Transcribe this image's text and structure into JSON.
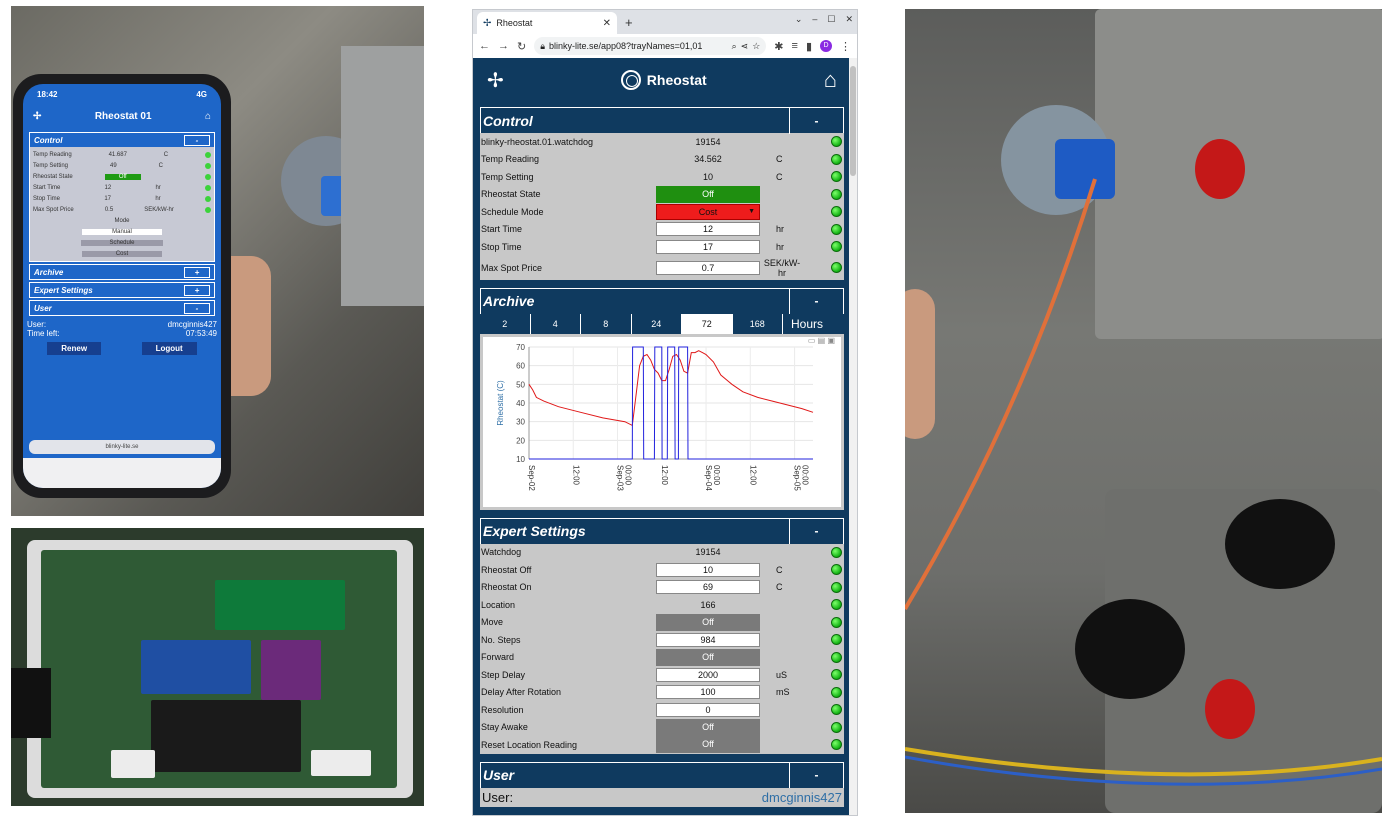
{
  "phone_photo": {
    "status_time": "18:42",
    "status_signal": "4G",
    "header_title": "Rheostat 01",
    "control_title": "Control",
    "control_toggle": "-",
    "rows": [
      {
        "label": "Temp Reading",
        "value": "41.687",
        "unit": "C"
      },
      {
        "label": "Temp Setting",
        "value": "49",
        "unit": "C"
      },
      {
        "label": "Rheostat State",
        "value": "Off",
        "unit": ""
      },
      {
        "label": "Start Time",
        "value": "12",
        "unit": "hr"
      },
      {
        "label": "Stop Time",
        "value": "17",
        "unit": "hr"
      },
      {
        "label": "Max Spot Price",
        "value": "0.5",
        "unit": "SEK/kW-hr"
      }
    ],
    "mode_label": "Mode",
    "mode_options": [
      "Manual",
      "Schedule",
      "Cost"
    ],
    "archive_title": "Archive",
    "archive_toggle": "+",
    "expert_title": "Expert Settings",
    "expert_toggle": "+",
    "user_title": "User",
    "user_toggle": "-",
    "user_label": "User:",
    "user_value": "dmcginnis427",
    "time_label": "Time left:",
    "time_value": "07:53:49",
    "renew_label": "Renew",
    "logout_label": "Logout",
    "url": "blinky-lite.se"
  },
  "browser": {
    "tab_title": "Rheostat",
    "new_tab": "+",
    "url": "blinky-lite.se/app08?trayNames=01,01",
    "profile_initial": "D"
  },
  "app": {
    "title": "Rheostat",
    "control": {
      "title": "Control",
      "toggle": "-",
      "rows": [
        {
          "label": "blinky-rheostat.01.watchdog",
          "value": "19154",
          "unit": "",
          "kind": "text"
        },
        {
          "label": "Temp Reading",
          "value": "34.562",
          "unit": "C",
          "kind": "text"
        },
        {
          "label": "Temp Setting",
          "value": "10",
          "unit": "C",
          "kind": "text"
        },
        {
          "label": "Rheostat State",
          "value": "Off",
          "unit": "",
          "kind": "green"
        },
        {
          "label": "Schedule Mode",
          "value": "Cost",
          "unit": "",
          "kind": "select"
        },
        {
          "label": "Start Time",
          "value": "12",
          "unit": "hr",
          "kind": "input"
        },
        {
          "label": "Stop Time",
          "value": "17",
          "unit": "hr",
          "kind": "input"
        },
        {
          "label": "Max Spot Price",
          "value": "0.7",
          "unit": "SEK/kW-hr",
          "kind": "input"
        }
      ]
    },
    "archive": {
      "title": "Archive",
      "toggle": "-",
      "hour_buttons": [
        "2",
        "4",
        "8",
        "24",
        "72",
        "168"
      ],
      "active_hours": "72",
      "hours_label": "Hours"
    },
    "expert": {
      "title": "Expert Settings",
      "toggle": "-",
      "rows": [
        {
          "label": "Watchdog",
          "value": "19154",
          "unit": "",
          "kind": "text"
        },
        {
          "label": "Rheostat Off",
          "value": "10",
          "unit": "C",
          "kind": "input"
        },
        {
          "label": "Rheostat On",
          "value": "69",
          "unit": "C",
          "kind": "input"
        },
        {
          "label": "Location",
          "value": "166",
          "unit": "",
          "kind": "text"
        },
        {
          "label": "Move",
          "value": "Off",
          "unit": "",
          "kind": "gray"
        },
        {
          "label": "No. Steps",
          "value": "984",
          "unit": "",
          "kind": "input"
        },
        {
          "label": "Forward",
          "value": "Off",
          "unit": "",
          "kind": "gray"
        },
        {
          "label": "Step Delay",
          "value": "2000",
          "unit": "uS",
          "kind": "input"
        },
        {
          "label": "Delay After Rotation",
          "value": "100",
          "unit": "mS",
          "kind": "input"
        },
        {
          "label": "Resolution",
          "value": "0",
          "unit": "",
          "kind": "input"
        },
        {
          "label": "Stay Awake",
          "value": "Off",
          "unit": "",
          "kind": "gray"
        },
        {
          "label": "Reset Location Reading",
          "value": "Off",
          "unit": "",
          "kind": "gray"
        }
      ]
    },
    "user": {
      "title": "User",
      "toggle": "-",
      "user_label": "User:",
      "user_value": "dmcginnis427"
    }
  },
  "colors": {
    "navy": "#0f3a5f",
    "panel_gray": "#c8c8c8",
    "indicator_green": "#18b818",
    "state_green": "#1f8f10",
    "select_red": "#ee1c1c",
    "series_temp": "#e01818",
    "series_state": "#2222dd"
  },
  "chart_data": {
    "type": "line",
    "ylabel": "Rheostat (C)",
    "ylim": [
      10,
      70
    ],
    "yticks": [
      10,
      20,
      30,
      40,
      50,
      60,
      70
    ],
    "xtick_labels": [
      "Sep-02",
      "12:00",
      "Sep-03",
      "00:00",
      "12:00",
      "Sep-04",
      "00:00",
      "12:00",
      "Sep-05",
      "00:00"
    ],
    "xtick_positions_hours": [
      0,
      12,
      24,
      24,
      36,
      48,
      48,
      60,
      72,
      72
    ],
    "x_range_hours": [
      0,
      77
    ],
    "series": [
      {
        "name": "",
        "color": "#e01818",
        "x": [
          0,
          1,
          2,
          4,
          8,
          14,
          20,
          26,
          28,
          29,
          30,
          31,
          32,
          33,
          34,
          35,
          36,
          37,
          38,
          39,
          40,
          41,
          42,
          43,
          44,
          45,
          46,
          47,
          48,
          50,
          52,
          55,
          58,
          62,
          66,
          70,
          74,
          77
        ],
        "y": [
          50,
          47,
          43,
          41,
          38,
          35,
          32,
          30,
          28,
          44,
          60,
          65,
          66,
          63,
          58,
          56,
          52,
          52,
          58,
          65,
          66,
          63,
          57,
          56,
          67,
          67,
          68,
          67,
          66,
          62,
          55,
          50,
          46,
          43,
          41,
          39,
          37,
          35
        ]
      },
      {
        "name": "",
        "color": "#2222dd",
        "x": [
          0,
          28,
          28.1,
          31,
          31.1,
          34,
          34.1,
          36,
          36.1,
          37.5,
          37.6,
          39.5,
          39.6,
          40.5,
          40.6,
          43,
          43.1,
          77
        ],
        "y": [
          10,
          10,
          70,
          70,
          10,
          10,
          70,
          70,
          10,
          10,
          70,
          70,
          10,
          10,
          70,
          70,
          10,
          10
        ]
      }
    ]
  }
}
